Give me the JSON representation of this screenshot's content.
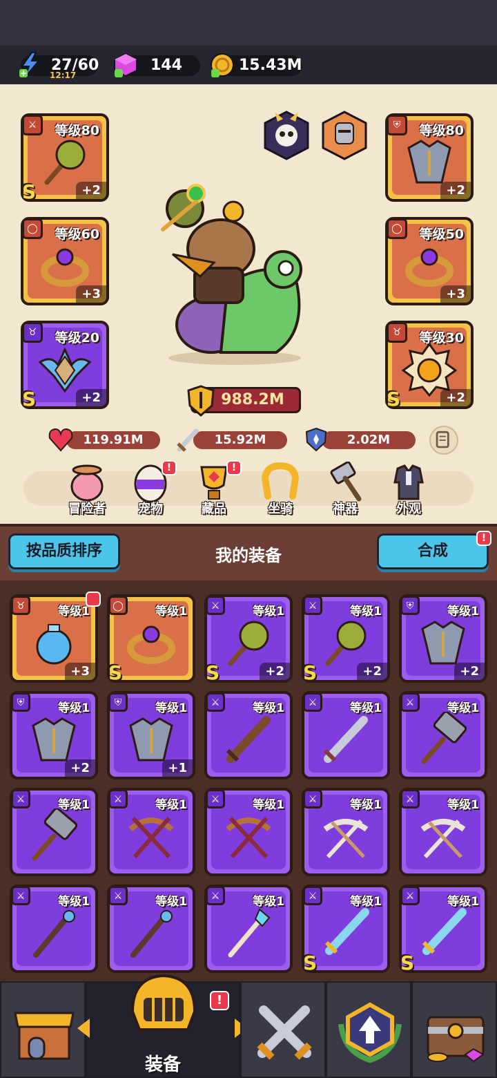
{
  "resources": {
    "energy": {
      "value": "27/60",
      "timer": "12:17",
      "icon": "lightning-icon"
    },
    "gems": {
      "value": "144",
      "icon": "gem-icon"
    },
    "gold": {
      "value": "15.43M",
      "icon": "coin-icon"
    }
  },
  "equipped": {
    "left": [
      {
        "level": "等级80",
        "plus": "+2",
        "rank": "S",
        "icon": "mace-icon",
        "quality": "gold"
      },
      {
        "level": "等级60",
        "plus": "+3",
        "rank": "",
        "icon": "ring-icon",
        "quality": "gold"
      },
      {
        "level": "等级20",
        "plus": "+2",
        "rank": "S",
        "icon": "amulet-icon",
        "quality": "purple"
      }
    ],
    "right": [
      {
        "level": "等级80",
        "plus": "+2",
        "rank": "",
        "icon": "armor-icon",
        "quality": "gold"
      },
      {
        "level": "等级50",
        "plus": "+3",
        "rank": "",
        "icon": "ring-icon",
        "quality": "gold"
      },
      {
        "level": "等级30",
        "plus": "+2",
        "rank": "S",
        "icon": "medal-icon",
        "quality": "gold"
      }
    ]
  },
  "power": "988.2M",
  "stats": {
    "hp": "119.91M",
    "atk": "15.92M",
    "def": "2.02M"
  },
  "nav": [
    {
      "label": "冒险者",
      "alert": false
    },
    {
      "label": "宠物",
      "alert": true
    },
    {
      "label": "藏品",
      "alert": true
    },
    {
      "label": "坐骑",
      "alert": false
    },
    {
      "label": "神器",
      "alert": false
    },
    {
      "label": "外观",
      "alert": false
    }
  ],
  "inventory_bar": {
    "sort_label": "按品质排序",
    "title": "我的装备",
    "merge_label": "合成",
    "merge_alert": "!"
  },
  "inventory": [
    {
      "level": "等级1",
      "plus": "+3",
      "rank": "",
      "quality": "gold",
      "icon": "potion-icon",
      "alert": true
    },
    {
      "level": "等级1",
      "plus": "",
      "rank": "S",
      "quality": "gold",
      "icon": "ring-icon",
      "alert": false
    },
    {
      "level": "等级1",
      "plus": "+2",
      "rank": "S",
      "quality": "purple",
      "icon": "mace-icon",
      "alert": false
    },
    {
      "level": "等级1",
      "plus": "+2",
      "rank": "S",
      "quality": "purple",
      "icon": "mace-icon",
      "alert": false
    },
    {
      "level": "等级1",
      "plus": "+2",
      "rank": "",
      "quality": "purple",
      "icon": "armor-icon",
      "alert": false
    },
    {
      "level": "等级1",
      "plus": "+2",
      "rank": "",
      "quality": "purple",
      "icon": "armor-icon",
      "alert": false
    },
    {
      "level": "等级1",
      "plus": "+1",
      "rank": "",
      "quality": "purple",
      "icon": "armor-icon",
      "alert": false
    },
    {
      "level": "等级1",
      "plus": "",
      "rank": "",
      "quality": "purple",
      "icon": "wooden-sword-icon",
      "alert": false
    },
    {
      "level": "等级1",
      "plus": "",
      "rank": "",
      "quality": "purple",
      "icon": "sword-icon",
      "alert": false
    },
    {
      "level": "等级1",
      "plus": "",
      "rank": "",
      "quality": "purple",
      "icon": "hammer-icon",
      "alert": false
    },
    {
      "level": "等级1",
      "plus": "",
      "rank": "",
      "quality": "purple",
      "icon": "hammer-icon",
      "alert": false
    },
    {
      "level": "等级1",
      "plus": "",
      "rank": "",
      "quality": "purple",
      "icon": "crossbow-icon",
      "alert": false
    },
    {
      "level": "等级1",
      "plus": "",
      "rank": "",
      "quality": "purple",
      "icon": "crossbow-icon",
      "alert": false
    },
    {
      "level": "等级1",
      "plus": "",
      "rank": "",
      "quality": "purple",
      "icon": "bone-bow-icon",
      "alert": false
    },
    {
      "level": "等级1",
      "plus": "",
      "rank": "",
      "quality": "purple",
      "icon": "bone-bow-icon",
      "alert": false
    },
    {
      "level": "等级1",
      "plus": "",
      "rank": "",
      "quality": "purple",
      "icon": "staff-icon",
      "alert": false
    },
    {
      "level": "等级1",
      "plus": "",
      "rank": "",
      "quality": "purple",
      "icon": "staff-icon",
      "alert": false
    },
    {
      "level": "等级1",
      "plus": "",
      "rank": "",
      "quality": "purple",
      "icon": "crystal-spear-icon",
      "alert": false
    },
    {
      "level": "等级1",
      "plus": "",
      "rank": "S",
      "quality": "purple",
      "icon": "ice-sword-icon",
      "alert": false
    },
    {
      "level": "等级1",
      "plus": "",
      "rank": "S",
      "quality": "purple",
      "icon": "ice-sword-icon",
      "alert": false
    }
  ],
  "bottom_tabs": [
    {
      "label": "",
      "icon": "shop-icon"
    },
    {
      "label": "装备",
      "icon": "helmet-icon",
      "active": true,
      "alert": "!"
    },
    {
      "label": "",
      "icon": "battle-swords-icon"
    },
    {
      "label": "",
      "icon": "upgrade-icon"
    },
    {
      "label": "",
      "icon": "treasure-chest-icon"
    }
  ],
  "colors": {
    "gold_frame": "#f6c245",
    "purple_frame": "#9d5ef0",
    "accent_blue": "#4cc6e8",
    "alert_red": "#e83a4b"
  }
}
